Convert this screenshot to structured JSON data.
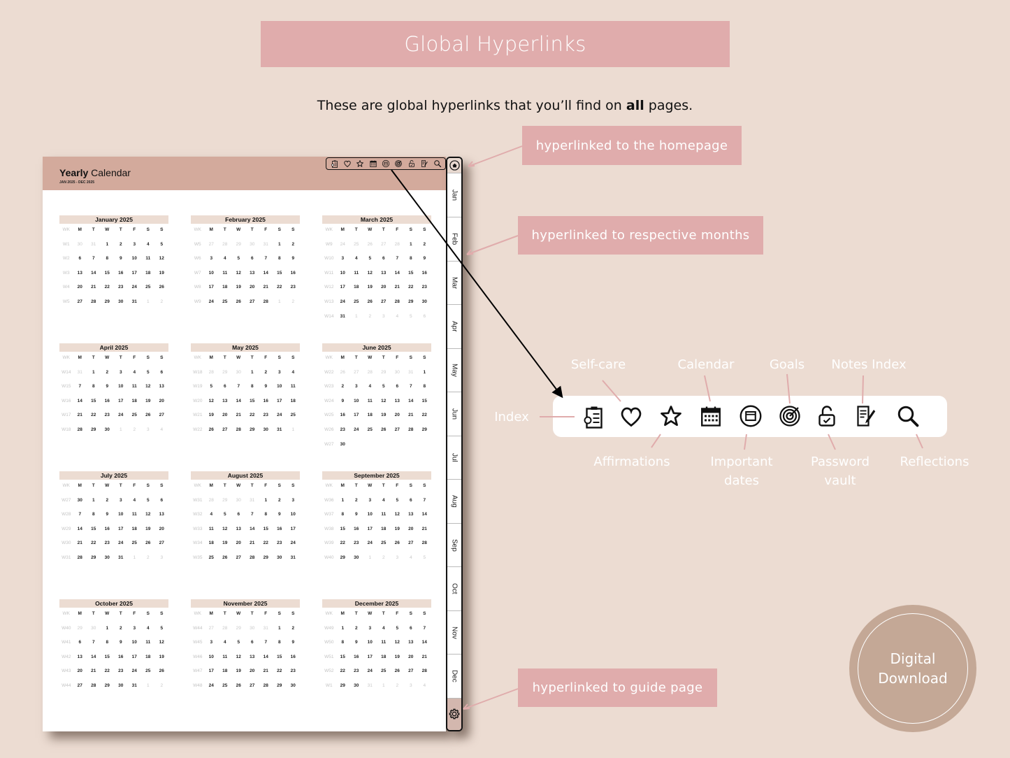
{
  "header": {
    "title": "Global Hyperlinks",
    "subtitle_pre": "These are global hyperlinks that you’ll find on ",
    "subtitle_bold": "all",
    "subtitle_post": " pages."
  },
  "callouts": {
    "home": "hyperlinked to the homepage",
    "months": "hyperlinked to respective months",
    "guide": "hyperlinked to guide page"
  },
  "planner": {
    "title_bold": "Yearly",
    "title_rest": " Calendar",
    "range": "JAN 2025 - DEC 2025",
    "toolbar_icons": [
      "index-icon",
      "heart-icon",
      "star-icon",
      "calendar-icon",
      "important-dates-icon",
      "goal-target-icon",
      "padlock-icon",
      "notes-icon",
      "search-icon"
    ],
    "tabs": [
      "Jan",
      "Feb",
      "Mar",
      "Apr",
      "May",
      "Jun",
      "Jul",
      "Aug",
      "Sep",
      "Oct",
      "Nov",
      "Dec"
    ],
    "weekday_headers": [
      "WK",
      "M",
      "T",
      "W",
      "T",
      "F",
      "S",
      "S"
    ],
    "months": [
      {
        "name": "January 2025",
        "weeks": [
          {
            "wk": "W1",
            "days": [
              "30",
              "31",
              "1",
              "2",
              "3",
              "4",
              "5"
            ],
            "dim": [
              0,
              1
            ]
          },
          {
            "wk": "W2",
            "days": [
              "6",
              "7",
              "8",
              "9",
              "10",
              "11",
              "12"
            ],
            "dim": []
          },
          {
            "wk": "W3",
            "days": [
              "13",
              "14",
              "15",
              "16",
              "17",
              "18",
              "19"
            ],
            "dim": []
          },
          {
            "wk": "W4",
            "days": [
              "20",
              "21",
              "22",
              "23",
              "24",
              "25",
              "26"
            ],
            "dim": []
          },
          {
            "wk": "W5",
            "days": [
              "27",
              "28",
              "29",
              "30",
              "31",
              "1",
              "2"
            ],
            "dim": [
              5,
              6
            ]
          }
        ]
      },
      {
        "name": "February 2025",
        "weeks": [
          {
            "wk": "W5",
            "days": [
              "27",
              "28",
              "29",
              "30",
              "31",
              "1",
              "2"
            ],
            "dim": [
              0,
              1,
              2,
              3,
              4
            ]
          },
          {
            "wk": "W6",
            "days": [
              "3",
              "4",
              "5",
              "6",
              "7",
              "8",
              "9"
            ],
            "dim": []
          },
          {
            "wk": "W7",
            "days": [
              "10",
              "11",
              "12",
              "13",
              "14",
              "15",
              "16"
            ],
            "dim": []
          },
          {
            "wk": "W8",
            "days": [
              "17",
              "18",
              "19",
              "20",
              "21",
              "22",
              "23"
            ],
            "dim": []
          },
          {
            "wk": "W9",
            "days": [
              "24",
              "25",
              "26",
              "27",
              "28",
              "1",
              "2"
            ],
            "dim": [
              5,
              6
            ]
          }
        ]
      },
      {
        "name": "March 2025",
        "weeks": [
          {
            "wk": "W9",
            "days": [
              "24",
              "25",
              "26",
              "27",
              "28",
              "1",
              "2"
            ],
            "dim": [
              0,
              1,
              2,
              3,
              4
            ]
          },
          {
            "wk": "W10",
            "days": [
              "3",
              "4",
              "5",
              "6",
              "7",
              "8",
              "9"
            ],
            "dim": []
          },
          {
            "wk": "W11",
            "days": [
              "10",
              "11",
              "12",
              "13",
              "14",
              "15",
              "16"
            ],
            "dim": []
          },
          {
            "wk": "W12",
            "days": [
              "17",
              "18",
              "19",
              "20",
              "21",
              "22",
              "23"
            ],
            "dim": []
          },
          {
            "wk": "W13",
            "days": [
              "24",
              "25",
              "26",
              "27",
              "28",
              "29",
              "30"
            ],
            "dim": []
          },
          {
            "wk": "W14",
            "days": [
              "31",
              "1",
              "2",
              "3",
              "4",
              "5",
              "6"
            ],
            "dim": [
              1,
              2,
              3,
              4,
              5,
              6
            ]
          }
        ]
      },
      {
        "name": "April 2025",
        "weeks": [
          {
            "wk": "W14",
            "days": [
              "31",
              "1",
              "2",
              "3",
              "4",
              "5",
              "6"
            ],
            "dim": [
              0
            ]
          },
          {
            "wk": "W15",
            "days": [
              "7",
              "8",
              "9",
              "10",
              "11",
              "12",
              "13"
            ],
            "dim": []
          },
          {
            "wk": "W16",
            "days": [
              "14",
              "15",
              "16",
              "17",
              "18",
              "19",
              "20"
            ],
            "dim": []
          },
          {
            "wk": "W17",
            "days": [
              "21",
              "22",
              "23",
              "24",
              "25",
              "26",
              "27"
            ],
            "dim": []
          },
          {
            "wk": "W18",
            "days": [
              "28",
              "29",
              "30",
              "1",
              "2",
              "3",
              "4"
            ],
            "dim": [
              3,
              4,
              5,
              6
            ]
          }
        ]
      },
      {
        "name": "May 2025",
        "weeks": [
          {
            "wk": "W18",
            "days": [
              "28",
              "29",
              "30",
              "1",
              "2",
              "3",
              "4"
            ],
            "dim": [
              0,
              1,
              2
            ]
          },
          {
            "wk": "W19",
            "days": [
              "5",
              "6",
              "7",
              "8",
              "9",
              "10",
              "11"
            ],
            "dim": []
          },
          {
            "wk": "W20",
            "days": [
              "12",
              "13",
              "14",
              "15",
              "16",
              "17",
              "18"
            ],
            "dim": []
          },
          {
            "wk": "W21",
            "days": [
              "19",
              "20",
              "21",
              "22",
              "23",
              "24",
              "25"
            ],
            "dim": []
          },
          {
            "wk": "W22",
            "days": [
              "26",
              "27",
              "28",
              "29",
              "30",
              "31",
              "1"
            ],
            "dim": [
              6
            ]
          }
        ]
      },
      {
        "name": "June 2025",
        "weeks": [
          {
            "wk": "W22",
            "days": [
              "26",
              "27",
              "28",
              "29",
              "30",
              "31",
              "1"
            ],
            "dim": [
              0,
              1,
              2,
              3,
              4,
              5
            ]
          },
          {
            "wk": "W23",
            "days": [
              "2",
              "3",
              "4",
              "5",
              "6",
              "7",
              "8"
            ],
            "dim": []
          },
          {
            "wk": "W24",
            "days": [
              "9",
              "10",
              "11",
              "12",
              "13",
              "14",
              "15"
            ],
            "dim": []
          },
          {
            "wk": "W25",
            "days": [
              "16",
              "17",
              "18",
              "19",
              "20",
              "21",
              "22"
            ],
            "dim": []
          },
          {
            "wk": "W26",
            "days": [
              "23",
              "24",
              "25",
              "26",
              "27",
              "28",
              "29"
            ],
            "dim": []
          },
          {
            "wk": "W27",
            "days": [
              "30",
              "",
              "",
              "",
              "",
              "",
              ""
            ],
            "dim": []
          }
        ]
      },
      {
        "name": "July 2025",
        "weeks": [
          {
            "wk": "W27",
            "days": [
              "30",
              "1",
              "2",
              "3",
              "4",
              "5",
              "6"
            ],
            "dim": []
          },
          {
            "wk": "W28",
            "days": [
              "7",
              "8",
              "9",
              "10",
              "11",
              "12",
              "13"
            ],
            "dim": []
          },
          {
            "wk": "W29",
            "days": [
              "14",
              "15",
              "16",
              "17",
              "18",
              "19",
              "20"
            ],
            "dim": []
          },
          {
            "wk": "W30",
            "days": [
              "21",
              "22",
              "23",
              "24",
              "25",
              "26",
              "27"
            ],
            "dim": []
          },
          {
            "wk": "W31",
            "days": [
              "28",
              "29",
              "30",
              "31",
              "1",
              "2",
              "3"
            ],
            "dim": [
              4,
              5,
              6
            ]
          }
        ]
      },
      {
        "name": "August 2025",
        "weeks": [
          {
            "wk": "W31",
            "days": [
              "28",
              "29",
              "30",
              "31",
              "1",
              "2",
              "3"
            ],
            "dim": [
              0,
              1,
              2,
              3
            ]
          },
          {
            "wk": "W32",
            "days": [
              "4",
              "5",
              "6",
              "7",
              "8",
              "9",
              "10"
            ],
            "dim": []
          },
          {
            "wk": "W33",
            "days": [
              "11",
              "12",
              "13",
              "14",
              "15",
              "16",
              "17"
            ],
            "dim": []
          },
          {
            "wk": "W34",
            "days": [
              "18",
              "19",
              "20",
              "21",
              "22",
              "23",
              "24"
            ],
            "dim": []
          },
          {
            "wk": "W35",
            "days": [
              "25",
              "26",
              "27",
              "28",
              "29",
              "30",
              "31"
            ],
            "dim": []
          }
        ]
      },
      {
        "name": "September 2025",
        "weeks": [
          {
            "wk": "W36",
            "days": [
              "1",
              "2",
              "3",
              "4",
              "5",
              "6",
              "7"
            ],
            "dim": []
          },
          {
            "wk": "W37",
            "days": [
              "8",
              "9",
              "10",
              "11",
              "12",
              "13",
              "14"
            ],
            "dim": []
          },
          {
            "wk": "W38",
            "days": [
              "15",
              "16",
              "17",
              "18",
              "19",
              "20",
              "21"
            ],
            "dim": []
          },
          {
            "wk": "W39",
            "days": [
              "22",
              "23",
              "24",
              "25",
              "26",
              "27",
              "28"
            ],
            "dim": []
          },
          {
            "wk": "W40",
            "days": [
              "29",
              "30",
              "1",
              "2",
              "3",
              "4",
              "5"
            ],
            "dim": [
              2,
              3,
              4,
              5,
              6
            ]
          }
        ]
      },
      {
        "name": "October 2025",
        "weeks": [
          {
            "wk": "W40",
            "days": [
              "29",
              "30",
              "1",
              "2",
              "3",
              "4",
              "5"
            ],
            "dim": [
              0,
              1
            ]
          },
          {
            "wk": "W41",
            "days": [
              "6",
              "7",
              "8",
              "9",
              "10",
              "11",
              "12"
            ],
            "dim": []
          },
          {
            "wk": "W42",
            "days": [
              "13",
              "14",
              "15",
              "16",
              "17",
              "18",
              "19"
            ],
            "dim": []
          },
          {
            "wk": "W43",
            "days": [
              "20",
              "21",
              "22",
              "23",
              "24",
              "25",
              "26"
            ],
            "dim": []
          },
          {
            "wk": "W44",
            "days": [
              "27",
              "28",
              "29",
              "30",
              "31",
              "1",
              "2"
            ],
            "dim": [
              5,
              6
            ]
          }
        ]
      },
      {
        "name": "November 2025",
        "weeks": [
          {
            "wk": "W44",
            "days": [
              "27",
              "28",
              "29",
              "30",
              "31",
              "1",
              "2"
            ],
            "dim": [
              0,
              1,
              2,
              3,
              4
            ]
          },
          {
            "wk": "W45",
            "days": [
              "3",
              "4",
              "5",
              "6",
              "7",
              "8",
              "9"
            ],
            "dim": []
          },
          {
            "wk": "W46",
            "days": [
              "10",
              "11",
              "12",
              "13",
              "14",
              "15",
              "16"
            ],
            "dim": []
          },
          {
            "wk": "W47",
            "days": [
              "17",
              "18",
              "19",
              "20",
              "21",
              "22",
              "23"
            ],
            "dim": []
          },
          {
            "wk": "W48",
            "days": [
              "24",
              "25",
              "26",
              "27",
              "28",
              "29",
              "30"
            ],
            "dim": []
          }
        ]
      },
      {
        "name": "December 2025",
        "weeks": [
          {
            "wk": "W49",
            "days": [
              "1",
              "2",
              "3",
              "4",
              "5",
              "6",
              "7"
            ],
            "dim": []
          },
          {
            "wk": "W50",
            "days": [
              "8",
              "9",
              "10",
              "11",
              "12",
              "13",
              "14"
            ],
            "dim": []
          },
          {
            "wk": "W51",
            "days": [
              "15",
              "16",
              "17",
              "18",
              "19",
              "20",
              "21"
            ],
            "dim": []
          },
          {
            "wk": "W52",
            "days": [
              "22",
              "23",
              "24",
              "25",
              "26",
              "27",
              "28"
            ],
            "dim": []
          },
          {
            "wk": "W1",
            "days": [
              "29",
              "30",
              "31",
              "1",
              "2",
              "3",
              "4"
            ],
            "dim": [
              2,
              3,
              4,
              5,
              6
            ]
          }
        ]
      }
    ]
  },
  "legend": [
    {
      "icon": "index-icon",
      "label": "Index"
    },
    {
      "icon": "heart-icon",
      "label": "Self-care"
    },
    {
      "icon": "star-icon",
      "label": "Affirmations"
    },
    {
      "icon": "calendar-icon",
      "label": "Calendar"
    },
    {
      "icon": "important-dates-icon",
      "label": "Important dates"
    },
    {
      "icon": "goal-target-icon",
      "label": "Goals"
    },
    {
      "icon": "padlock-icon",
      "label": "Password vault"
    },
    {
      "icon": "notes-icon",
      "label": "Notes Index"
    },
    {
      "icon": "search-icon",
      "label": "Reflections"
    }
  ],
  "badge": {
    "line1": "Digital",
    "line2": "Download"
  },
  "colors": {
    "background": "#ecdcd2",
    "accent_pink": "#e0acac",
    "header_mauve": "#d3aa9c",
    "badge_tan": "#c4a896"
  }
}
